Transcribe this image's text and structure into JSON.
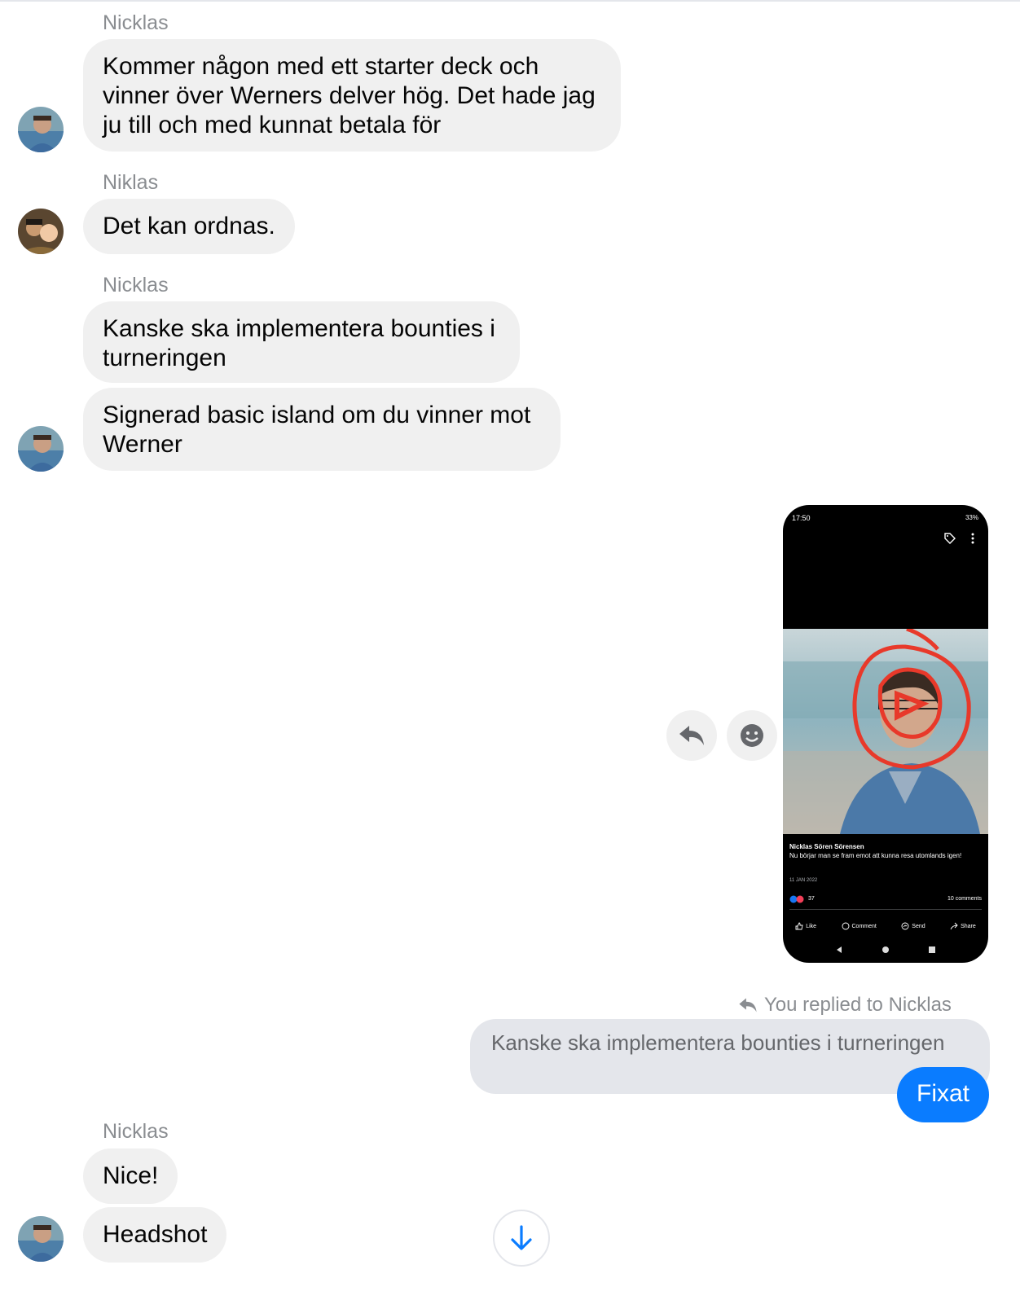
{
  "messages": {
    "group1": {
      "sender": "Nicklas",
      "text": "Kommer någon med ett starter deck och vinner över Werners delver hög. Det hade jag ju till och med kunnat betala för"
    },
    "group2": {
      "sender": "Niklas",
      "text": "Det kan ordnas."
    },
    "group3": {
      "sender": "Nicklas",
      "text1": "Kanske ska implementera bounties i turneringen",
      "text2": "Signerad basic island om du vinner mot Werner"
    },
    "group4": {
      "sender": "Nicklas",
      "text1": "Nice!",
      "text2": "Headshot"
    }
  },
  "shared_image": {
    "status_time": "17:50",
    "status_battery": "33%",
    "post_author": "Nicklas Sören Sörensen",
    "post_caption": "Nu börjar man se fram emot att kunna resa utomlands igen!",
    "post_date": "11 JAN 2022",
    "reactions_count": "37",
    "comments_count": "10 comments",
    "action_like": "Like",
    "action_comment": "Comment",
    "action_send": "Send",
    "action_share": "Share"
  },
  "reply": {
    "replied_label": "You replied to Nicklas",
    "quoted_text": "Kanske ska implementera bounties i turneringen",
    "reply_text": "Fixat"
  },
  "colors": {
    "accent": "#0a7cff",
    "bubble_gray": "#f0f0f0",
    "annotation_red": "#e8392a"
  }
}
